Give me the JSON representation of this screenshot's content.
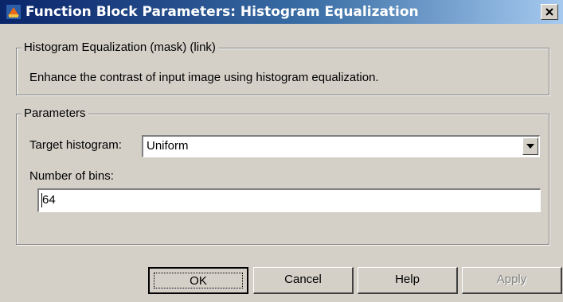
{
  "window": {
    "title": "Function Block Parameters: Histogram Equalization"
  },
  "mask_group": {
    "title": "Histogram Equalization (mask) (link)",
    "description": "Enhance the contrast of input image using histogram equalization."
  },
  "parameters": {
    "title": "Parameters",
    "target_histogram": {
      "label": "Target histogram:",
      "value": "Uniform"
    },
    "number_of_bins": {
      "label": "Number of bins:",
      "value": "64"
    }
  },
  "buttons": {
    "ok": "OK",
    "cancel": "Cancel",
    "help": "Help",
    "apply": "Apply"
  },
  "icons": {
    "app": "simulink-block-icon",
    "close": "close-icon",
    "dropdown": "chevron-down-icon"
  },
  "colors": {
    "title_bar_start": "#0a246a",
    "title_bar_end": "#a6caf0",
    "dialog_face": "#d4d0c8"
  }
}
